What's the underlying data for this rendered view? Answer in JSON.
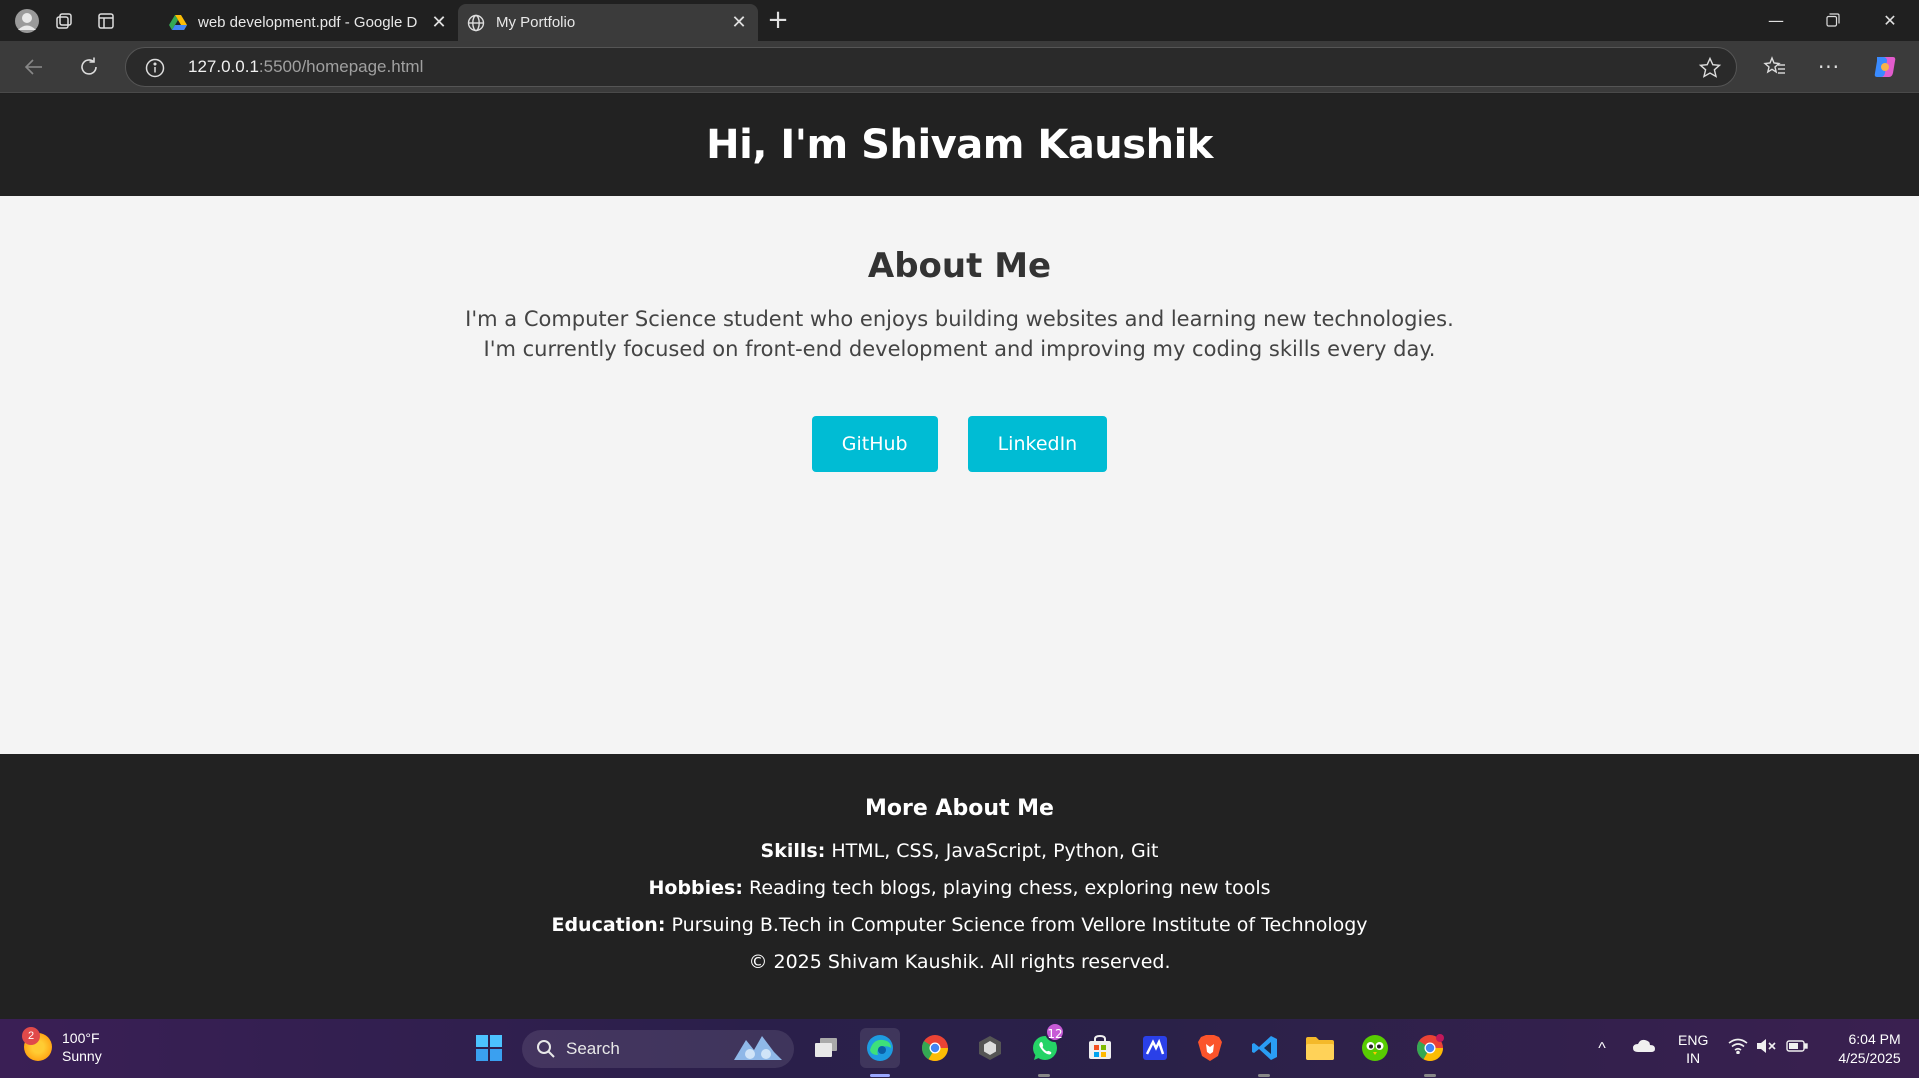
{
  "browser": {
    "tabs": [
      {
        "title": "web development.pdf - Google D",
        "active": false,
        "icon": "google-drive-icon"
      },
      {
        "title": "My Portfolio",
        "active": true,
        "icon": "globe-icon"
      }
    ],
    "address": {
      "host": "127.0.0.1",
      "rest": ":5500/homepage.html"
    }
  },
  "page": {
    "hero_title": "Hi, I'm Shivam Kaushik",
    "about_heading": "About Me",
    "about_line1": "I'm a Computer Science student who enjoys building websites and learning new technologies.",
    "about_line2": "I'm currently focused on front-end development and improving my coding skills every day.",
    "github_label": "GitHub",
    "linkedin_label": "LinkedIn",
    "footer": {
      "heading": "More About Me",
      "skills_label": "Skills:",
      "skills_value": " HTML, CSS, JavaScript, Python, Git",
      "hobbies_label": "Hobbies:",
      "hobbies_value": " Reading tech blogs, playing chess, exploring new tools",
      "education_label": "Education:",
      "education_value": " Pursuing B.Tech in Computer Science from Vellore Institute of Technology",
      "copyright": "© 2025 Shivam Kaushik. All rights reserved."
    },
    "colors": {
      "header_bg": "#222222",
      "button_bg": "#00bcd4",
      "page_bg": "#f4f4f4"
    }
  },
  "taskbar": {
    "weather_temp": "100°F",
    "weather_desc": "Sunny",
    "weather_badge": "2",
    "search_label": "Search",
    "whatsapp_badge": "12",
    "lang_top": "ENG",
    "lang_bottom": "IN",
    "time": "6:04 PM",
    "date": "4/25/2025"
  }
}
